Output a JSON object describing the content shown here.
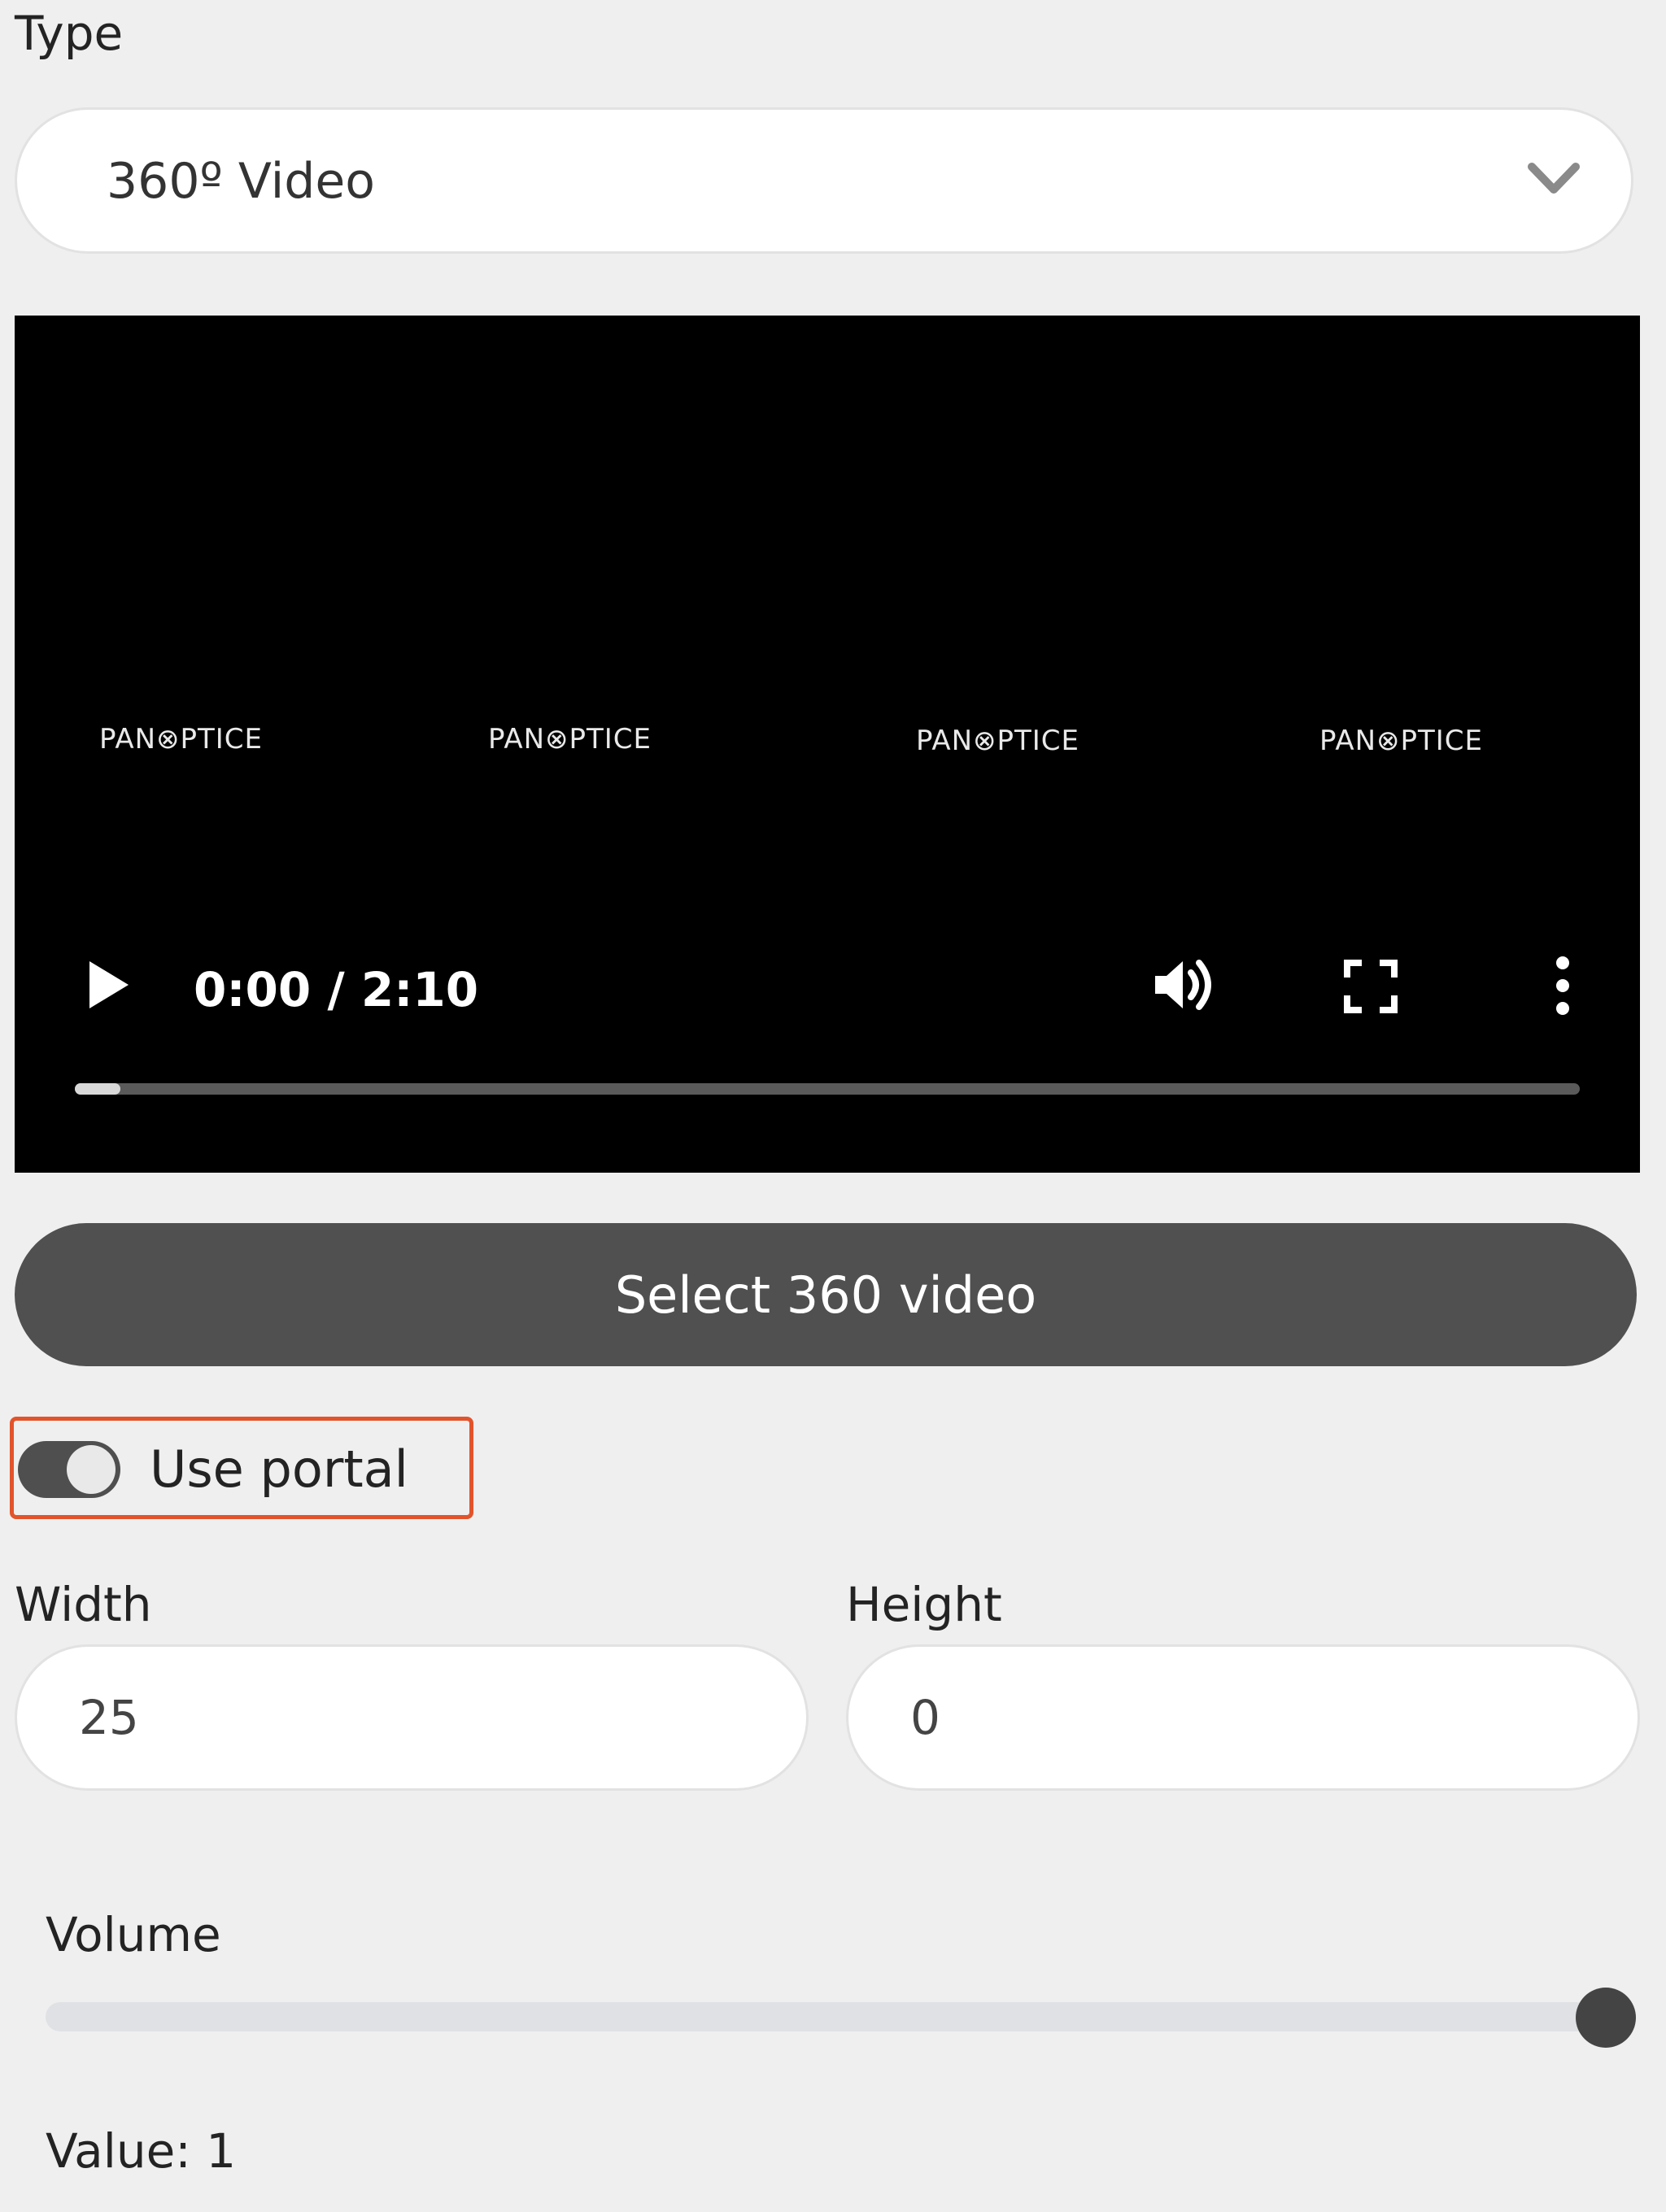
{
  "type_field": {
    "label": "Type",
    "selected": "360º Video"
  },
  "video": {
    "watermarks": [
      "PAN⊗PTICE",
      "PAN⊗PTICE",
      "PAN⊗PTICE",
      "PAN⊗PTICE"
    ],
    "time": "0:00 / 2:10",
    "progress_fraction": 0.03
  },
  "select_button": {
    "label": "Select 360 video"
  },
  "portal_toggle": {
    "label": "Use portal",
    "on": true
  },
  "dimensions": {
    "width_label": "Width",
    "width_value": "25",
    "height_label": "Height",
    "height_value": "0"
  },
  "volume": {
    "label": "Volume",
    "value": 1,
    "value_prefix": "Value: ",
    "value_text": "1"
  },
  "colors": {
    "highlight": "#e2542b",
    "button_bg": "#505050",
    "page_bg": "#efefef"
  }
}
